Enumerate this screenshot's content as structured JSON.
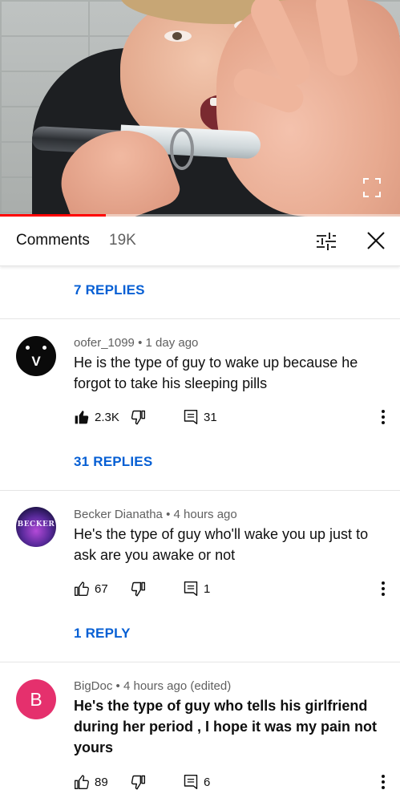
{
  "header": {
    "title": "Comments",
    "count": "19K"
  },
  "video": {
    "progress": 0.265
  },
  "top_replies": "7 REPLIES",
  "comments": [
    {
      "avatar_letter": "V",
      "author": "oofer_1099",
      "separator": "•",
      "time": "1 day ago",
      "text": "He is the type of guy to wake up because he forgot to take his sleeping pills",
      "likes": "2.3K",
      "liked": true,
      "replies_count": "31",
      "replies_link": "31 REPLIES"
    },
    {
      "avatar_logo": "BECKER",
      "author": "Becker Dianatha",
      "separator": "•",
      "time": "4 hours ago",
      "text": "He's the type of guy who'll wake you up just to ask are you awake or not",
      "likes": "67",
      "liked": false,
      "replies_count": "1",
      "replies_link": "1 REPLY"
    },
    {
      "avatar_letter": "B",
      "author": "BigDoc",
      "separator": "•",
      "time": "4 hours ago (edited)",
      "text": "He's the type of guy who tells his girlfriend during her period , I hope it was my pain not yours",
      "likes": "89",
      "liked": false,
      "replies_count": "6"
    }
  ],
  "colors": {
    "link_blue": "#065fd4",
    "progress_red": "#ff0000",
    "avatar_pink": "#e5306d"
  },
  "icons": [
    "fullscreen-icon",
    "sort-filter-icon",
    "close-icon",
    "thumbs-up-icon",
    "thumbs-down-icon",
    "reply-icon",
    "more-vert-icon"
  ]
}
